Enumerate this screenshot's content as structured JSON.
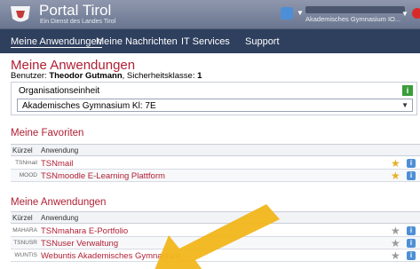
{
  "header": {
    "title": "Portal Tirol",
    "subtitle": "Ein Dienst des Landes Tirol",
    "user_org": "Akademisches Gymnasium IO...",
    "colors": {
      "accent": "#b01f34",
      "nav": "#2f3f5e",
      "info": "#4d8fd6",
      "star_active": "#e4b12a",
      "org_info": "#3a9d3a"
    }
  },
  "nav": {
    "items": [
      "Meine Anwendungen",
      "Meine Nachrichten",
      "IT Services",
      "Support"
    ],
    "active": "Meine Anwendungen"
  },
  "page": {
    "title": "Meine Anwendungen",
    "user_prefix": "Benutzer: ",
    "user_name": "Theodor Gutmann",
    "class_prefix": ", Sicherheitsklasse: ",
    "class_value": "1"
  },
  "org": {
    "label": "Organisationseinheit",
    "info_icon": "i",
    "selected": "Akademisches Gymnasium Kl: 7E"
  },
  "favorites": {
    "title": "Meine Favoriten",
    "columns": [
      "Kürzel",
      "Anwendung"
    ],
    "rows": [
      {
        "kurzel": "TSNmail",
        "name": "TSNmail",
        "starred": true
      },
      {
        "kurzel": "MOOD",
        "name": "TSNmoodle E-Learning Plattform",
        "starred": true
      }
    ]
  },
  "apps": {
    "title": "Meine Anwendungen",
    "columns": [
      "Kürzel",
      "Anwendung"
    ],
    "rows": [
      {
        "kurzel": "MAHARA",
        "name": "TSNmahara E-Portfolio",
        "starred": false
      },
      {
        "kurzel": "TSNUSR",
        "name": "TSNuser Verwaltung",
        "starred": false
      },
      {
        "kurzel": "WUNTIS",
        "name": "Webuntis Akademisches Gymnasium",
        "starred": false
      }
    ]
  }
}
